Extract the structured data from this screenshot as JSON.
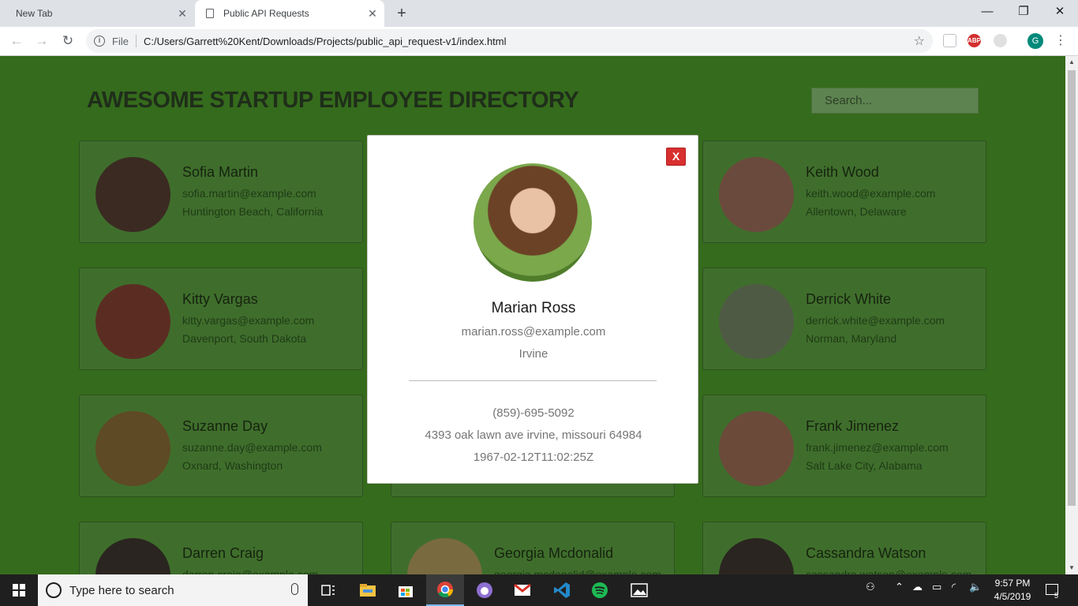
{
  "browser": {
    "tabs": [
      {
        "title": "New Tab",
        "active": false
      },
      {
        "title": "Public API Requests",
        "active": true
      }
    ],
    "new_tab_symbol": "+",
    "close_symbol": "✕",
    "scheme_label": "File",
    "url": "C:/Users/Garrett%20Kent/Downloads/Projects/public_api_request-v1/index.html",
    "icons": [
      "back-arrow-icon",
      "forward-arrow-icon",
      "reload-icon",
      "info-icon",
      "star-icon",
      "extension-icon",
      "adblock-icon",
      "profile-avatar-icon",
      "menu-dots-icon"
    ],
    "abp_label": "ABP",
    "profile_initial": "G",
    "window_controls": {
      "minimize": "—",
      "restore": "❐",
      "close": "✕"
    }
  },
  "page": {
    "title": "AWESOME STARTUP EMPLOYEE DIRECTORY",
    "search_placeholder": "Search...",
    "background_color": "#356b1c",
    "employees": [
      {
        "name": "Sofia Martin",
        "email": "sofia.martin@example.com",
        "location": "Huntington Beach, California",
        "avatar_color": "#3b2a22"
      },
      {
        "name": "Keith Wood",
        "email": "keith.wood@example.com",
        "location": "Allentown, Delaware",
        "avatar_color": "#6a4a3c"
      },
      {
        "name": "Kitty Vargas",
        "email": "kitty.vargas@example.com",
        "location": "Davenport, South Dakota",
        "avatar_color": "#5b2d22"
      },
      {
        "name": "Derrick White",
        "email": "derrick.white@example.com",
        "location": "Norman, Maryland",
        "avatar_color": "#4f5a44"
      },
      {
        "name": "Suzanne Day",
        "email": "suzanne.day@example.com",
        "location": "Oxnard, Washington",
        "avatar_color": "#5e4a25"
      },
      {
        "name": "Frank Jimenez",
        "email": "frank.jimenez@example.com",
        "location": "Salt Lake City, Alabama",
        "avatar_color": "#6b4a3a"
      },
      {
        "name": "Darren Craig",
        "email": "darren.craig@example.com",
        "location": "",
        "avatar_color": "#2a2520"
      },
      {
        "name": "Georgia Mcdonalid",
        "email": "georgia.mcdonalid@example.com",
        "location": "",
        "avatar_color": "#7a6a40"
      },
      {
        "name": "Cassandra Watson",
        "email": "cassandra.watson@example.com",
        "location": "",
        "avatar_color": "#2a2520"
      }
    ],
    "modal": {
      "close_label": "X",
      "name": "Marian Ross",
      "email": "marian.ross@example.com",
      "city": "Irvine",
      "phone": "(859)-695-5092",
      "address": "4393 oak lawn ave irvine, missouri 64984",
      "birthday": "1967-02-12T11:02:25Z"
    }
  },
  "taskbar": {
    "search_placeholder": "Type here to search",
    "apps": [
      "task-view-icon",
      "file-explorer-icon",
      "store-icon",
      "chrome-icon",
      "github-icon",
      "gmail-icon",
      "vscode-icon",
      "spotify-icon",
      "photos-icon"
    ],
    "time": "9:57 PM",
    "date": "4/5/2019",
    "notification_count": "5"
  }
}
